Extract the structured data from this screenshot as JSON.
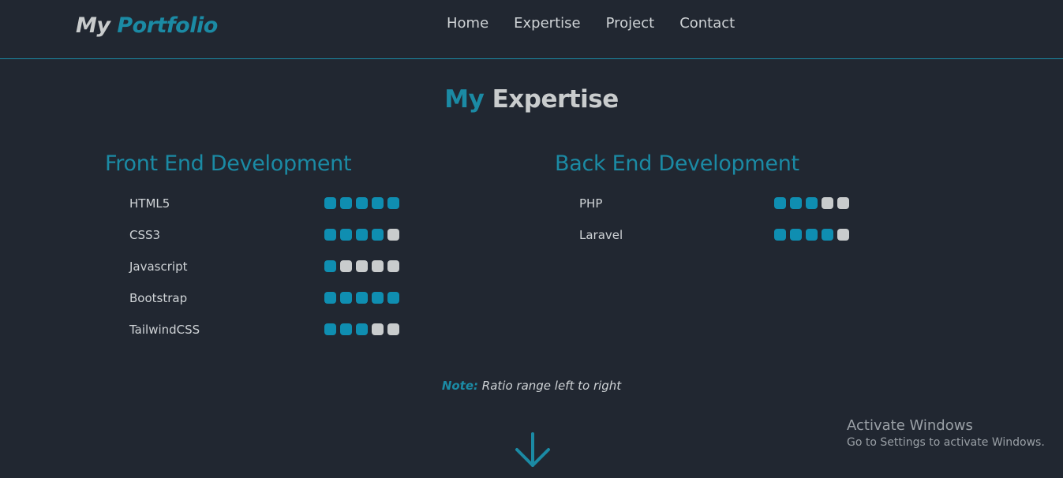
{
  "header": {
    "logo_word1": "My",
    "logo_word2": "Portfolio",
    "nav": [
      "Home",
      "Expertise",
      "Project",
      "Contact"
    ]
  },
  "section": {
    "title_word1": "My",
    "title_word2": "Expertise"
  },
  "front_end": {
    "heading": "Front End Development",
    "skills": [
      {
        "name": "HTML5",
        "rating": 5
      },
      {
        "name": "CSS3",
        "rating": 4
      },
      {
        "name": "Javascript",
        "rating": 1
      },
      {
        "name": "Bootstrap",
        "rating": 5
      },
      {
        "name": "TailwindCSS",
        "rating": 3
      }
    ]
  },
  "back_end": {
    "heading": "Back End Development",
    "skills": [
      {
        "name": "PHP",
        "rating": 3
      },
      {
        "name": "Laravel",
        "rating": 4
      }
    ]
  },
  "rating_max": 5,
  "note": {
    "label": "Note:",
    "text": "Ratio range left to right"
  },
  "scroll_icon": "arrow-down-icon",
  "colors": {
    "accent": "#1b8aa4",
    "dot_on": "#0f8eb1",
    "dot_off": "#c9cccd",
    "background": "#212731"
  },
  "watermark": {
    "title": "Activate Windows",
    "subtitle": "Go to Settings to activate Windows."
  }
}
